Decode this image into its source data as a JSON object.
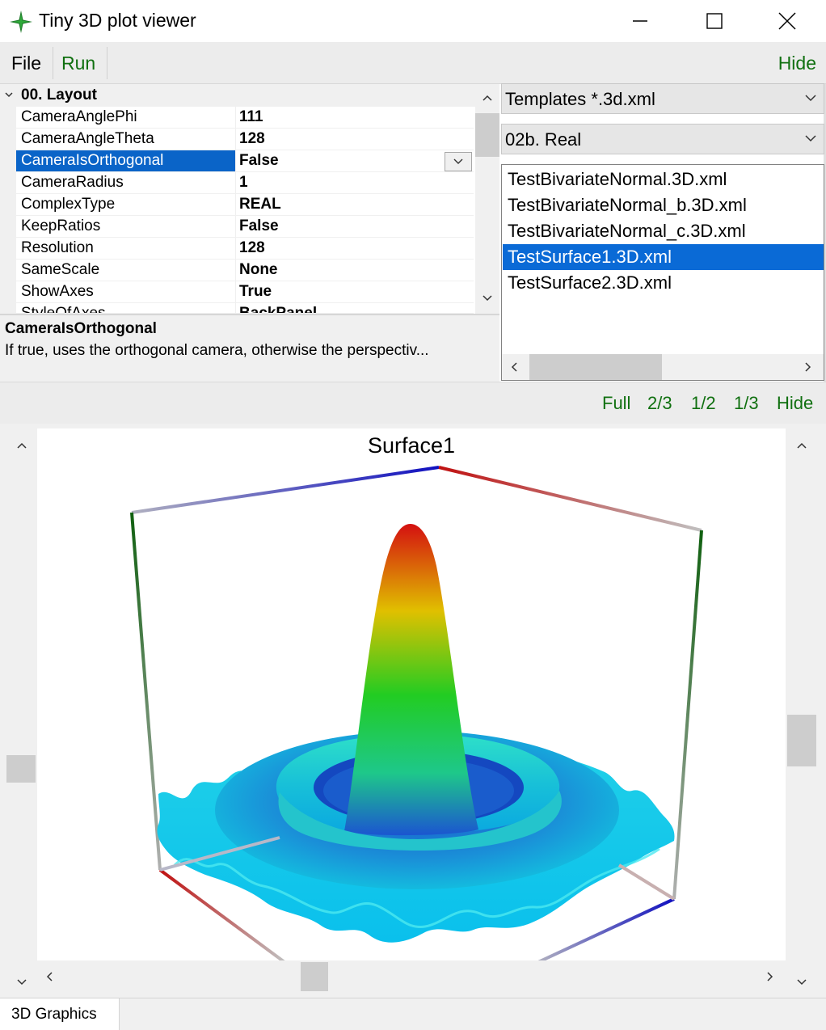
{
  "window": {
    "title": "Tiny 3D plot viewer"
  },
  "menu": {
    "file": "File",
    "run": "Run",
    "hide": "Hide"
  },
  "properties": {
    "category": "00. Layout",
    "rows": [
      {
        "name": "CameraAnglePhi",
        "value": "111"
      },
      {
        "name": "CameraAngleTheta",
        "value": "128"
      },
      {
        "name": "CameraIsOrthogonal",
        "value": "False"
      },
      {
        "name": "CameraRadius",
        "value": "1"
      },
      {
        "name": "ComplexType",
        "value": "REAL"
      },
      {
        "name": "KeepRatios",
        "value": "False"
      },
      {
        "name": "Resolution",
        "value": "128"
      },
      {
        "name": "SameScale",
        "value": "None"
      },
      {
        "name": "ShowAxes",
        "value": "True"
      },
      {
        "name": "StyleOfAxes",
        "value": "BackPanel"
      }
    ],
    "selected": "CameraIsOrthogonal"
  },
  "description": {
    "title": "CameraIsOrthogonal",
    "text": "If true, uses the orthogonal camera, otherwise the perspectiv..."
  },
  "templates": {
    "filter": "Templates *.3d.xml",
    "group": "02b. Real",
    "files": [
      "TestBivariateNormal.3D.xml",
      "TestBivariateNormal_b.3D.xml",
      "TestBivariateNormal_c.3D.xml",
      "TestSurface1.3D.xml",
      "TestSurface2.3D.xml"
    ],
    "selected": "TestSurface1.3D.xml"
  },
  "view_sizes": {
    "full": "Full",
    "two_thirds": "2/3",
    "half": "1/2",
    "third": "1/3",
    "hide": "Hide"
  },
  "plot": {
    "title": "Surface1"
  },
  "tabs": {
    "graphics": "3D Graphics"
  },
  "colors": {
    "accent_green": "#107010",
    "selection_blue": "#0a64c8"
  }
}
